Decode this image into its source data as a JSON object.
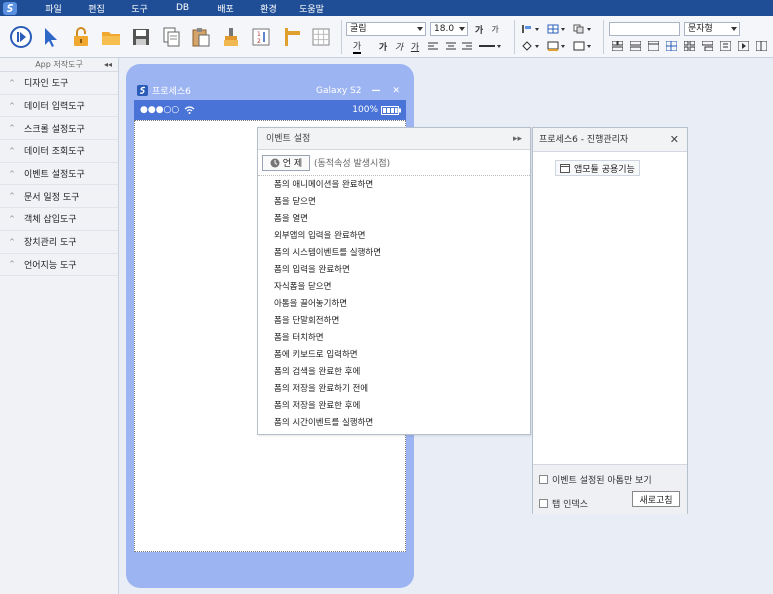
{
  "menubar": {
    "items": [
      "파일",
      "편집",
      "도구",
      "DB",
      "배포",
      "환경",
      "도움말"
    ]
  },
  "toolbar": {
    "font_family": "굴림",
    "font_size": "18.0",
    "text_type": "문자형"
  },
  "left_panel": {
    "header": "App 저작도구",
    "collapse": "◂◂",
    "items": [
      "디자인 도구",
      "데이터 입력도구",
      "스크롤 설정도구",
      "데이터 조회도구",
      "이벤트 설정도구",
      "문서 일정 도구",
      "객체 삽입도구",
      "장치관리 도구",
      "언어지능 도구"
    ]
  },
  "device": {
    "process_name": "프로세스6",
    "model": "Galaxy S2",
    "battery": "100%"
  },
  "event_panel": {
    "title": "이벤트 설정",
    "expand": "▸▸",
    "when_button": "언 제",
    "when_hint": "(동적속성 발생시점)",
    "events": [
      "폼의 애니메이션을 완료하면",
      "폼을 닫으면",
      "폼을 열면",
      "외부앱의 입력을 완료하면",
      "폼의 시스템이벤트를 실행하면",
      "폼의 입력을 완료하면",
      "자식폼을 닫으면",
      "아톰을 끌어놓기하면",
      "폼을 단말회전하면",
      "폼을 터치하면",
      "폼에 키보드로 입력하면",
      "폼의 검색을 완료한 후에",
      "폼의 저장을 완료하기 전에",
      "폼의 저장을 완료한 후에",
      "폼의 시간이벤트를 실행하면"
    ]
  },
  "progress_panel": {
    "title": "프로세스6 - 진행관리자",
    "close": "✕",
    "app_share": "앱모듈 공용기능",
    "show_event_atoms": "이벤트 설정된 아톰만 보기",
    "tab_index": "탭 인덱스",
    "refresh": "새로고침"
  },
  "colors": {
    "menubar": "#1f4e96",
    "device_frame": "#9db4f2",
    "device_status": "#4a73d8"
  }
}
